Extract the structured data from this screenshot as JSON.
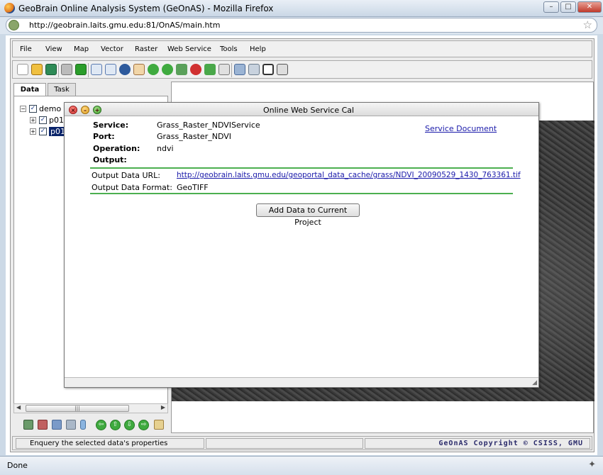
{
  "window": {
    "title": "GeoBrain Online Analysis System (GeOnAS) - Mozilla Firefox"
  },
  "browser": {
    "url": "http://geobrain.laits.gmu.edu:81/OnAS/main.htm",
    "status": "Done"
  },
  "menu": [
    "File",
    "View",
    "Map",
    "Vector",
    "Raster",
    "Web Service",
    "Tools",
    "Help"
  ],
  "left_panel": {
    "tabs": [
      "Data",
      "Task"
    ],
    "tree": [
      {
        "label": "demo",
        "checked": true,
        "selected": false
      },
      {
        "label": "p01",
        "checked": true,
        "selected": false
      },
      {
        "label": "p01",
        "checked": true,
        "selected": true
      }
    ]
  },
  "dialog": {
    "title": "Online Web Service Cal",
    "service_label": "Service:",
    "service_value": "Grass_Raster_NDVIService",
    "port_label": "Port:",
    "port_value": "Grass_Raster_NDVI",
    "operation_label": "Operation:",
    "operation_value": "ndvi",
    "output_label": "Output:",
    "service_doc_link": "Service Document",
    "output_url_label": "Output Data URL:",
    "output_url_value": "http://geobrain.laits.gmu.edu/geoportal_data_cache/grass/NDVI_20090529_1430_763361.tif",
    "output_format_label": "Output Data Format:",
    "output_format_value": "GeoTIFF",
    "add_button": "Add Data to Current Project"
  },
  "app_status": {
    "message": "Enquery the selected data's properties",
    "copyright": "GeOnAS Copyright © CSISS, GMU"
  },
  "colors": {
    "accent_green": "#4caf50",
    "link": "#1a1aaa",
    "selection": "#0a246a"
  }
}
